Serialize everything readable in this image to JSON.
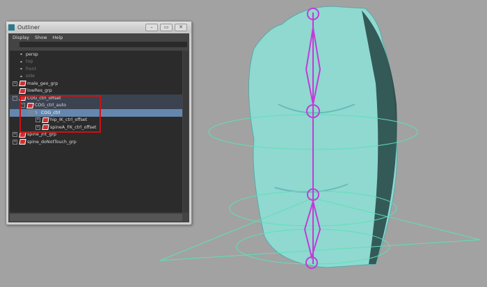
{
  "window": {
    "title": "Outliner",
    "minimize": "–",
    "maximize": "▭",
    "close": "✕"
  },
  "menu": [
    "Display",
    "Show",
    "Help"
  ],
  "filter": {
    "value": ""
  },
  "items": [
    {
      "label": "persp",
      "depth": 0,
      "type": "camera",
      "state": "normal",
      "expander": ""
    },
    {
      "label": "top",
      "depth": 0,
      "type": "camera",
      "state": "dim",
      "expander": ""
    },
    {
      "label": "front",
      "depth": 0,
      "type": "camera",
      "state": "dim",
      "expander": ""
    },
    {
      "label": "side",
      "depth": 0,
      "type": "camera",
      "state": "dim",
      "expander": ""
    },
    {
      "label": "male_geo_grp",
      "depth": 0,
      "type": "group",
      "state": "normal",
      "expander": "+"
    },
    {
      "label": "lowRes_grp",
      "depth": 0,
      "type": "group",
      "state": "normal",
      "expander": ""
    },
    {
      "label": "COG_ctrl_offset",
      "depth": 0,
      "type": "group",
      "state": "parent",
      "expander": "−"
    },
    {
      "label": "COG_ctrl_auto",
      "depth": 1,
      "type": "group",
      "state": "parent",
      "expander": "−"
    },
    {
      "label": "COG_ctrl",
      "depth": 2,
      "type": "curve",
      "state": "selected",
      "expander": "−"
    },
    {
      "label": "hip_IK_ctrl_offset",
      "depth": 3,
      "type": "group",
      "state": "normal",
      "expander": "+"
    },
    {
      "label": "spineA_FK_ctrl_offset",
      "depth": 3,
      "type": "group",
      "state": "normal",
      "expander": "+"
    },
    {
      "label": "spine_jnt_grp",
      "depth": 0,
      "type": "group",
      "state": "normal",
      "expander": "+"
    },
    {
      "label": "spine_doNotTouch_grp",
      "depth": 0,
      "type": "group",
      "state": "normal",
      "expander": "+"
    }
  ],
  "colors": {
    "mesh": "#8fd9d0",
    "rig": "#c43ad8",
    "highlight": "#d01010",
    "selection": "#6587ad"
  }
}
